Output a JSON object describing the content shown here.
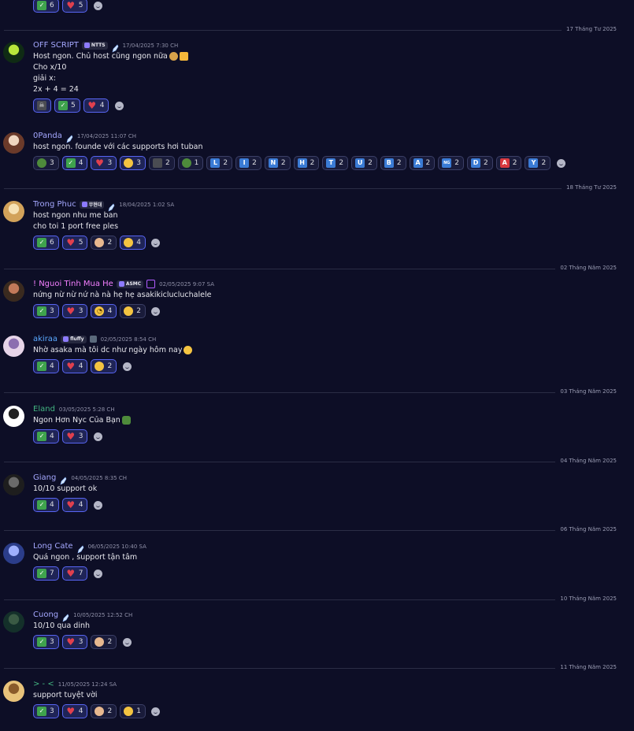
{
  "colors": {
    "background": "#0d0e26",
    "accent": "#5865f2",
    "check": "#3fa34d",
    "heart": "#e0404e",
    "letter": "#3a7bd5"
  },
  "dividers": [
    "17 Tháng Tư 2025",
    "18 Tháng Tư 2025",
    "02 Tháng Năm 2025",
    "03 Tháng Năm 2025",
    "04 Tháng Năm 2025",
    "06 Tháng Năm 2025",
    "10 Tháng Năm 2025",
    "11 Tháng Năm 2025"
  ],
  "top_reactions": [
    {
      "emoji": "check",
      "count": "6"
    },
    {
      "emoji": "heart",
      "count": "5"
    }
  ],
  "messages": [
    {
      "name": "OFF SCRIPT",
      "name_color": "#a5a8ff",
      "tag": "NTTS",
      "time": "17/04/2025 7:30 CH",
      "lines": [
        "Host ngon. Chủ host cũng ngon nữa",
        "Cho x/10",
        "giải  x:",
        "2x + 4 = 24"
      ],
      "reactions": [
        {
          "emoji": "skull",
          "count": ""
        },
        {
          "emoji": "check",
          "count": "5"
        },
        {
          "emoji": "heart",
          "count": "4"
        }
      ]
    },
    {
      "name": "0Panda",
      "name_color": "#a5a8ff",
      "time": "17/04/2025 11:07 CH",
      "lines": [
        "host ngon. founde với các supports hơi tuban"
      ],
      "reactions": [
        {
          "emoji": "car",
          "count": "3"
        },
        {
          "emoji": "check",
          "count": "4"
        },
        {
          "emoji": "heart",
          "count": "3"
        },
        {
          "emoji": "laugh",
          "count": "3"
        },
        {
          "emoji": "stone",
          "count": "2"
        },
        {
          "emoji": "turtle",
          "count": "1"
        },
        {
          "emoji": "L",
          "count": "2"
        },
        {
          "emoji": "I",
          "count": "2"
        },
        {
          "emoji": "N",
          "count": "2"
        },
        {
          "emoji": "H",
          "count": "2"
        },
        {
          "emoji": "T",
          "count": "2"
        },
        {
          "emoji": "U",
          "count": "2"
        },
        {
          "emoji": "B",
          "count": "2"
        },
        {
          "emoji": "A",
          "count": "2"
        },
        {
          "emoji": "NG",
          "count": "2"
        },
        {
          "emoji": "D",
          "count": "2"
        },
        {
          "emoji": "A-red",
          "count": "2"
        },
        {
          "emoji": "Y",
          "count": "2"
        }
      ]
    },
    {
      "name": "Trong Phuc",
      "name_color": "#a5a8ff",
      "tag": "무현대",
      "time": "18/04/2025 1:02 SA",
      "lines": [
        "host ngon nhu me ban",
        "cho toi 1 port free ples"
      ],
      "reactions": [
        {
          "emoji": "check",
          "count": "6"
        },
        {
          "emoji": "heart",
          "count": "5"
        },
        {
          "emoji": "anime",
          "count": "2"
        },
        {
          "emoji": "blob",
          "count": "4"
        }
      ]
    },
    {
      "name": "! Nguoi Tinh Mua He",
      "name_color": "#f47fff",
      "tag": "ASMC",
      "time": "02/05/2025 9:07 SA",
      "lines": [
        "nứng nừ nừ nứ nà nà hẹ hẹ asakikiclucluchalele"
      ],
      "reactions": [
        {
          "emoji": "check",
          "count": "3"
        },
        {
          "emoji": "heart",
          "count": "3"
        },
        {
          "emoji": "nerd",
          "count": "4"
        },
        {
          "emoji": "grin",
          "count": "2"
        }
      ]
    },
    {
      "name": "akiraa",
      "name_color": "#5aa9ff",
      "tag": "fluffy",
      "time": "02/05/2025 8:54 CH",
      "lines": [
        "Nhờ asaka mà tôi dc như ngày hôm nay"
      ],
      "reactions": [
        {
          "emoji": "check",
          "count": "4"
        },
        {
          "emoji": "heart",
          "count": "4"
        },
        {
          "emoji": "blob",
          "count": "2"
        }
      ]
    },
    {
      "name": "Eland",
      "name_color": "#43b581",
      "time": "03/05/2025 5:28 CH",
      "lines": [
        "Ngon Hơn Nyc Của Bạn"
      ],
      "reactions": [
        {
          "emoji": "check",
          "count": "4"
        },
        {
          "emoji": "heart",
          "count": "3"
        }
      ]
    },
    {
      "name": "Giang",
      "name_color": "#a5a8ff",
      "time": "04/05/2025 8:35 CH",
      "lines": [
        "10/10 support ok"
      ],
      "reactions": [
        {
          "emoji": "check",
          "count": "4"
        },
        {
          "emoji": "heart",
          "count": "4"
        }
      ]
    },
    {
      "name": "Long Cate",
      "name_color": "#a5a8ff",
      "time": "06/05/2025 10:40 SA",
      "lines": [
        "Quá ngon , support tận tâm"
      ],
      "reactions": [
        {
          "emoji": "check",
          "count": "7"
        },
        {
          "emoji": "heart",
          "count": "7"
        }
      ]
    },
    {
      "name": "Cuong",
      "name_color": "#a5a8ff",
      "time": "10/05/2025 12:52 CH",
      "lines": [
        "10/10 qua dinh"
      ],
      "reactions": [
        {
          "emoji": "check",
          "count": "3"
        },
        {
          "emoji": "heart",
          "count": "3"
        },
        {
          "emoji": "pray",
          "count": "2"
        }
      ]
    },
    {
      "name": "> - <",
      "name_color": "#43b581",
      "time": "11/05/2025 12:24 SA",
      "lines": [
        "support tuyệt vời"
      ],
      "reactions": [
        {
          "emoji": "check",
          "count": "3"
        },
        {
          "emoji": "heart",
          "count": "4"
        },
        {
          "emoji": "pray",
          "count": "2"
        },
        {
          "emoji": "money",
          "count": "1"
        }
      ]
    }
  ]
}
